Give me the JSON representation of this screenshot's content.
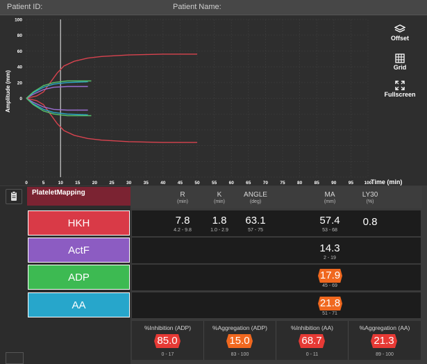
{
  "header": {
    "patient_id_label": "Patient ID:",
    "patient_name_label": "Patient Name:"
  },
  "toolbar": {
    "offset": "Offset",
    "grid": "Grid",
    "fullscreen": "Fullscreen"
  },
  "chart_data": {
    "type": "line",
    "xlabel": "Time (min)",
    "ylabel": "Amplitude (mm)",
    "xlim": [
      0,
      100
    ],
    "ylim": [
      -100,
      100
    ],
    "xticks": [
      "0",
      "5",
      "10",
      "15",
      "20",
      "25",
      "30",
      "35",
      "40",
      "45",
      "50",
      "55",
      "60",
      "65",
      "70",
      "75",
      "80",
      "85",
      "90",
      "95",
      "100"
    ],
    "yticks": [
      "100",
      "80",
      "60",
      "40",
      "20",
      "0"
    ],
    "cursor_x": 10,
    "series": [
      {
        "color": "#d9434f",
        "points": [
          [
            0,
            0
          ],
          [
            3,
            3
          ],
          [
            5,
            8
          ],
          [
            7,
            20
          ],
          [
            9,
            32
          ],
          [
            11,
            41
          ],
          [
            14,
            47
          ],
          [
            18,
            51
          ],
          [
            22,
            53
          ],
          [
            30,
            55
          ],
          [
            40,
            56
          ],
          [
            50,
            56
          ]
        ]
      },
      {
        "color": "#d9434f",
        "points": [
          [
            0,
            0
          ],
          [
            3,
            -3
          ],
          [
            5,
            -8
          ],
          [
            7,
            -20
          ],
          [
            9,
            -32
          ],
          [
            11,
            -41
          ],
          [
            14,
            -47
          ],
          [
            18,
            -51
          ],
          [
            22,
            -53
          ],
          [
            30,
            -55
          ],
          [
            40,
            -56
          ],
          [
            50,
            -56
          ]
        ]
      },
      {
        "color": "#9a6fd1",
        "points": [
          [
            0,
            0
          ],
          [
            2,
            5
          ],
          [
            5,
            11
          ],
          [
            8,
            14
          ],
          [
            12,
            15
          ],
          [
            18,
            15
          ]
        ]
      },
      {
        "color": "#9a6fd1",
        "points": [
          [
            0,
            0
          ],
          [
            2,
            -5
          ],
          [
            5,
            -11
          ],
          [
            8,
            -14
          ],
          [
            12,
            -15
          ],
          [
            18,
            -15
          ]
        ]
      },
      {
        "color": "#2aa7c9",
        "points": [
          [
            0,
            0
          ],
          [
            2,
            7
          ],
          [
            5,
            14
          ],
          [
            8,
            18
          ],
          [
            12,
            20
          ],
          [
            18,
            21
          ]
        ]
      },
      {
        "color": "#2aa7c9",
        "points": [
          [
            0,
            0
          ],
          [
            2,
            -7
          ],
          [
            5,
            -14
          ],
          [
            8,
            -18
          ],
          [
            12,
            -20
          ],
          [
            18,
            -21
          ]
        ]
      },
      {
        "color": "#56c26a",
        "points": [
          [
            0,
            0
          ],
          [
            2,
            8
          ],
          [
            5,
            16
          ],
          [
            8,
            20
          ],
          [
            12,
            22
          ],
          [
            19,
            22
          ]
        ]
      },
      {
        "color": "#56c26a",
        "points": [
          [
            0,
            0
          ],
          [
            2,
            -8
          ],
          [
            5,
            -16
          ],
          [
            8,
            -20
          ],
          [
            12,
            -22
          ],
          [
            19,
            -22
          ]
        ]
      }
    ]
  },
  "panel": {
    "tab_label": "PlateletMapping"
  },
  "columns": [
    {
      "name": "R",
      "unit": "(min)"
    },
    {
      "name": "K",
      "unit": "(min)"
    },
    {
      "name": "ANGLE",
      "unit": "(deg)"
    },
    {
      "name": "MA",
      "unit": "(mm)"
    },
    {
      "name": "LY30",
      "unit": "(%)"
    }
  ],
  "rows": [
    {
      "label": "HKH",
      "color": "#d93a47",
      "r": "7.8",
      "r_range": "4.2 - 9.8",
      "k": "1.8",
      "k_range": "1.0 - 2.9",
      "angle": "63.1",
      "angle_range": "57 - 75",
      "ma": "57.4",
      "ma_range": "53 - 68",
      "ly30": "0.8"
    },
    {
      "label": "ActF",
      "color": "#8c5cc2",
      "ma": "14.3",
      "ma_range": "2 - 19"
    },
    {
      "label": "ADP",
      "color": "#3dba52",
      "ma": "17.9",
      "ma_range": "45 - 69"
    },
    {
      "label": "AA",
      "color": "#27a6cb",
      "ma": "21.8",
      "ma_range": "51 - 71"
    }
  ],
  "stats": [
    {
      "title": "%Inhibition (ADP)",
      "value": "85.0",
      "range": "0 - 17",
      "color": "#e73a35"
    },
    {
      "title": "%Aggregation (ADP)",
      "value": "15.0",
      "range": "83 - 100",
      "color": "#f0681f"
    },
    {
      "title": "%Inhibition (AA)",
      "value": "68.7",
      "range": "0 - 11",
      "color": "#e73a35"
    },
    {
      "title": "%Aggregation (AA)",
      "value": "21.3",
      "range": "89 - 100",
      "color": "#e73a35"
    }
  ]
}
